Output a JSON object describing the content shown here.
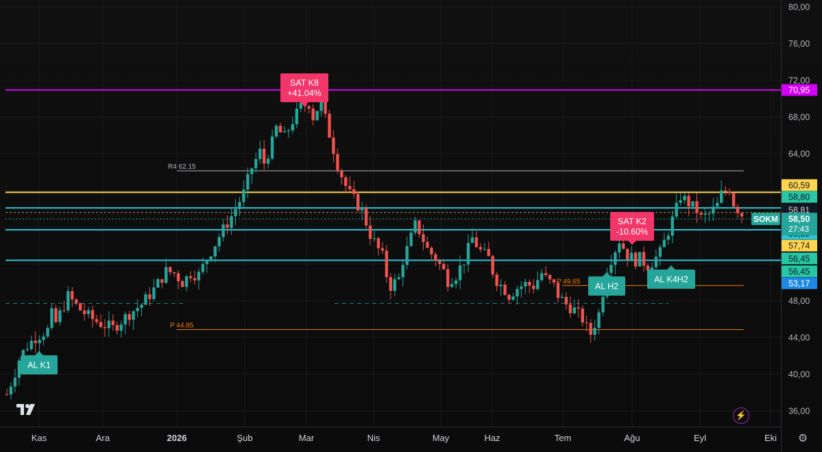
{
  "chart_data": {
    "type": "candlestick",
    "symbol": "SOKM",
    "price_axis": {
      "range": [
        35,
        81
      ],
      "ticks": [
        "80,00",
        "76,00",
        "72,00",
        "68,00",
        "64,00",
        "48,00",
        "44,00",
        "40,00",
        "36,00"
      ]
    },
    "time_axis": {
      "labels": [
        {
          "text": "Kas",
          "bold": false
        },
        {
          "text": "Ara",
          "bold": false
        },
        {
          "text": "2026",
          "bold": true
        },
        {
          "text": "Şub",
          "bold": false
        },
        {
          "text": "Mar",
          "bold": false
        },
        {
          "text": "Nis",
          "bold": false
        },
        {
          "text": "May",
          "bold": false
        },
        {
          "text": "Haz",
          "bold": false
        },
        {
          "text": "Tem",
          "bold": false
        },
        {
          "text": "Ağu",
          "bold": false
        },
        {
          "text": "Eyl",
          "bold": false
        },
        {
          "text": "Eki",
          "bold": false
        }
      ]
    },
    "horizontal_lines": [
      {
        "price": 70.95,
        "color": "#d500f9"
      },
      {
        "price": 59.8,
        "color": "#ffd54f"
      },
      {
        "price": 58.1,
        "color": "#26c6da"
      },
      {
        "price": 55.72,
        "color": "#26c6da"
      },
      {
        "price": 52.4,
        "color": "#26c6da"
      }
    ],
    "pivot_lines": [
      {
        "label": "R4",
        "value": "62.15",
        "price": 62.15,
        "color": "#b2b5be"
      },
      {
        "label": "P",
        "value": "49.65",
        "price": 49.65,
        "color": "#f57c00"
      },
      {
        "label": "P",
        "value": "44.85",
        "price": 44.85,
        "color": "#f57c00"
      }
    ],
    "price_badges": [
      {
        "text": "70,95",
        "price": 70.95,
        "bg": "#d500f9",
        "fg": "#ffffff"
      },
      {
        "text": "60,59",
        "price": 60.59,
        "bg": "#ffd54f",
        "fg": "#131722"
      },
      {
        "text": "58,80",
        "price": 59.3,
        "bg": "#26c6a6",
        "fg": "#131722"
      },
      {
        "text": "58,81",
        "price": 57.9,
        "bg": "#131722",
        "fg": "#d1d4dc"
      },
      {
        "text": "58,39",
        "price": 55.3,
        "bg": "#26c6da",
        "fg": "#131722"
      },
      {
        "text": "57,74",
        "price": 54.0,
        "bg": "#ffd54f",
        "fg": "#131722"
      },
      {
        "text": "56,45",
        "price": 52.6,
        "bg": "#26c6a6",
        "fg": "#131722"
      },
      {
        "text": "56,45",
        "price": 51.2,
        "bg": "#26c6a6",
        "fg": "#131722"
      },
      {
        "text": "53,17",
        "price": 49.9,
        "bg": "#1e88e5",
        "fg": "#ffffff"
      }
    ],
    "current_price": {
      "symbol": "SOKM",
      "price": "58,50",
      "countdown": "27:43",
      "color": "#26a69a"
    },
    "signals": [
      {
        "lines": [
          "AL K1"
        ],
        "type": "buy"
      },
      {
        "lines": [
          "SAT K8",
          "+41.04%"
        ],
        "type": "sell"
      },
      {
        "lines": [
          "SAT K2",
          "-10.60%"
        ],
        "type": "sell"
      },
      {
        "lines": [
          "AL H2"
        ],
        "type": "buy"
      },
      {
        "lines": [
          "AL K4H2"
        ],
        "type": "buy"
      }
    ],
    "candles_shape": [
      [
        0,
        37.8
      ],
      [
        2,
        40.2
      ],
      [
        3,
        41.6
      ],
      [
        4,
        42.4
      ],
      [
        5,
        43.1
      ],
      [
        7,
        44.0
      ],
      [
        10,
        44.8
      ],
      [
        11,
        46.5
      ],
      [
        12,
        45.6
      ],
      [
        15,
        48.5
      ],
      [
        16,
        48.0
      ],
      [
        18,
        47.0
      ],
      [
        21,
        46.0
      ],
      [
        23,
        45.5
      ],
      [
        26,
        45.0
      ],
      [
        28,
        45.8
      ],
      [
        30,
        46.6
      ],
      [
        33,
        47.6
      ],
      [
        36,
        49.2
      ],
      [
        39,
        51.2
      ],
      [
        41,
        51.0
      ],
      [
        43,
        50.0
      ],
      [
        45,
        51.0
      ],
      [
        47,
        50.8
      ],
      [
        49,
        52.6
      ],
      [
        52,
        55.0
      ],
      [
        55,
        57.2
      ],
      [
        58,
        59.7
      ],
      [
        60,
        62.5
      ],
      [
        62,
        64.2
      ],
      [
        63,
        63.0
      ],
      [
        65,
        65.2
      ],
      [
        66,
        66.8
      ],
      [
        68,
        65.8
      ],
      [
        70,
        67.6
      ],
      [
        72,
        69.1
      ],
      [
        74,
        69.5
      ],
      [
        75,
        68.0
      ],
      [
        77,
        69.8
      ],
      [
        78,
        67.8
      ],
      [
        80,
        64.5
      ],
      [
        81,
        62.8
      ],
      [
        83,
        60.5
      ],
      [
        84,
        59.6
      ],
      [
        86,
        58.4
      ],
      [
        87,
        57.8
      ],
      [
        89,
        55.2
      ],
      [
        90,
        54.4
      ],
      [
        92,
        52.8
      ],
      [
        93,
        50.8
      ],
      [
        94,
        49.6
      ],
      [
        96,
        50.4
      ],
      [
        97,
        52.4
      ],
      [
        98,
        53.6
      ],
      [
        100,
        56.2
      ],
      [
        101,
        55.6
      ],
      [
        103,
        53.6
      ],
      [
        105,
        52.6
      ],
      [
        107,
        51.2
      ],
      [
        108,
        50.2
      ],
      [
        110,
        50.8
      ],
      [
        112,
        52.4
      ],
      [
        113,
        53.6
      ],
      [
        114,
        54.8
      ],
      [
        116,
        53.4
      ],
      [
        118,
        52.6
      ],
      [
        119,
        51.2
      ],
      [
        120,
        50.2
      ],
      [
        122,
        49.2
      ],
      [
        123,
        48.6
      ],
      [
        125,
        49.4
      ],
      [
        127,
        49.8
      ],
      [
        129,
        49.6
      ],
      [
        131,
        51.0
      ],
      [
        132,
        50.4
      ],
      [
        134,
        49.6
      ],
      [
        135,
        48.6
      ],
      [
        137,
        47.6
      ],
      [
        139,
        47.0
      ],
      [
        141,
        46.0
      ],
      [
        142,
        45.0
      ],
      [
        143,
        44.4
      ],
      [
        145,
        46.6
      ],
      [
        146,
        49.0
      ],
      [
        147,
        51.6
      ],
      [
        149,
        53.6
      ],
      [
        150,
        54.6
      ],
      [
        152,
        53.0
      ],
      [
        154,
        52.4
      ],
      [
        155,
        52.6
      ],
      [
        157,
        51.8
      ],
      [
        158,
        52.2
      ],
      [
        160,
        53.2
      ],
      [
        162,
        55.6
      ],
      [
        164,
        58.0
      ],
      [
        165,
        59.4
      ],
      [
        167,
        58.6
      ],
      [
        169,
        57.8
      ],
      [
        170,
        57.0
      ],
      [
        172,
        57.4
      ],
      [
        174,
        58.4
      ],
      [
        175,
        59.6
      ],
      [
        177,
        60.2
      ],
      [
        178,
        58.6
      ],
      [
        180,
        57.4
      ]
    ]
  }
}
